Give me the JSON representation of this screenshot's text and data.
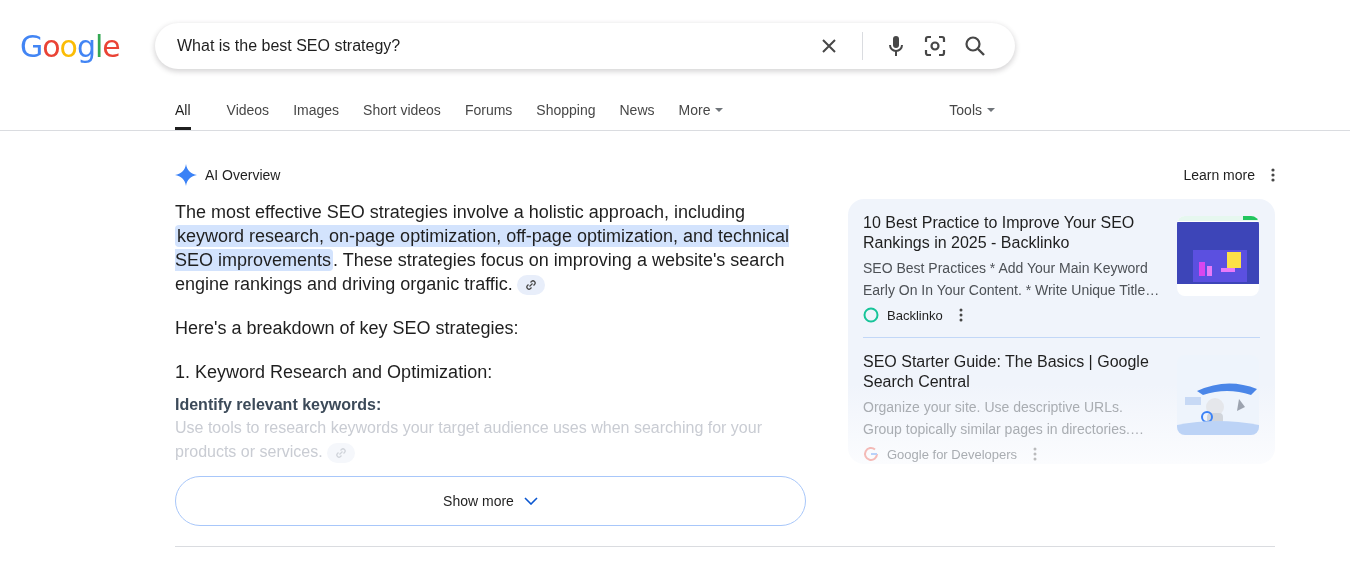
{
  "logo": "Google",
  "search": {
    "value": "What is the best SEO strategy?"
  },
  "tabs": [
    {
      "label": "All",
      "selected": true,
      "kind": "plain"
    },
    {
      "label": "Videos",
      "selected": false,
      "kind": "plain"
    },
    {
      "label": "Images",
      "selected": false,
      "kind": "plain"
    },
    {
      "label": "Short videos",
      "selected": false,
      "kind": "plain"
    },
    {
      "label": "Forums",
      "selected": false,
      "kind": "plain"
    },
    {
      "label": "Shopping",
      "selected": false,
      "kind": "plain"
    },
    {
      "label": "News",
      "selected": false,
      "kind": "plain"
    },
    {
      "label": "More",
      "selected": false,
      "kind": "menu"
    }
  ],
  "tools": "Tools",
  "overview": {
    "title": "AI Overview",
    "learn_more": "Learn more",
    "blocks": [
      {
        "kind": "paragraph",
        "faded": false,
        "citation": true,
        "segments": [
          {
            "text": "The most effective SEO strategies involve a holistic approach, including ",
            "highlighted": false
          },
          {
            "text": "keyword research, on-page optimization, off-page optimization, and technical SEO improvements",
            "highlighted": true
          },
          {
            "text": ". These strategies focus on improving a website's search engine rankings and driving organic traffic.",
            "highlighted": false
          }
        ]
      },
      {
        "kind": "paragraph",
        "faded": false,
        "citation": false,
        "segments": [
          {
            "text": "Here's a breakdown of key SEO strategies:",
            "highlighted": false
          }
        ]
      },
      {
        "kind": "heading",
        "text": "1. Keyword Research and Optimization:"
      },
      {
        "kind": "subheading",
        "text": "Identify relevant keywords:"
      },
      {
        "kind": "paragraph",
        "faded": true,
        "citation": true,
        "segments": [
          {
            "text": "Use tools to research keywords your target audience uses when searching for your products or services.",
            "highlighted": false
          }
        ]
      }
    ],
    "show_more": "Show more"
  },
  "sources": [
    {
      "title": "10 Best Practice to Improve Your SEO Rankings in 2025 - Backlinko",
      "snippet": "SEO Best Practices * Add Your Main Keyword Early On In Your Content. * Write Unique Title…",
      "site": "Backlinko",
      "faded": false
    },
    {
      "title": "SEO Starter Guide: The Basics | Google Search Central",
      "snippet": "Organize your site. Use descriptive URLs. Group topically similar pages in directories.…",
      "site": "Google for Developers",
      "faded": true
    }
  ]
}
